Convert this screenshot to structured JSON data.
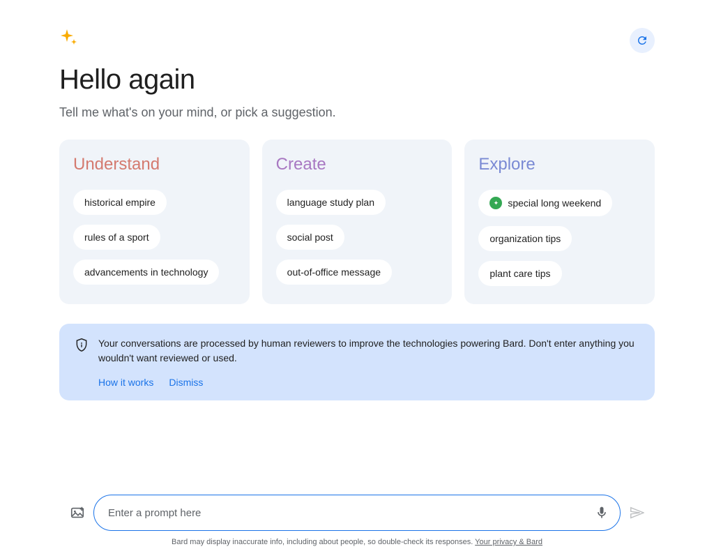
{
  "greeting": "Hello again",
  "subtitle": "Tell me what's on your mind, or pick a suggestion.",
  "cards": {
    "understand": {
      "title": "Understand",
      "chips": [
        {
          "label": "historical empire"
        },
        {
          "label": "rules of a sport"
        },
        {
          "label": "advancements in technology"
        }
      ]
    },
    "create": {
      "title": "Create",
      "chips": [
        {
          "label": "language study plan"
        },
        {
          "label": "social post"
        },
        {
          "label": "out-of-office message"
        }
      ]
    },
    "explore": {
      "title": "Explore",
      "chips": [
        {
          "label": "special long weekend",
          "has_icon": true
        },
        {
          "label": "organization tips"
        },
        {
          "label": "plant care tips"
        }
      ]
    }
  },
  "notice": {
    "text": "Your conversations are processed by human reviewers to improve the technologies powering Bard. Don't enter anything you wouldn't want reviewed or used.",
    "how_it_works": "How it works",
    "dismiss": "Dismiss"
  },
  "input": {
    "placeholder": "Enter a prompt here"
  },
  "disclaimer": {
    "text": "Bard may display inaccurate info, including about people, so double-check its responses. ",
    "link_label": "Your privacy & Bard"
  }
}
